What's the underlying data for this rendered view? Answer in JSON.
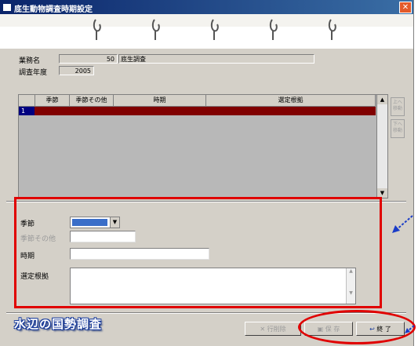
{
  "window": {
    "title": "底生動物調査時期設定",
    "close_glyph": "✕"
  },
  "info": {
    "business_name_label": "業務名",
    "business_code": "50",
    "business_name": "底生調査",
    "survey_year_label": "調査年度",
    "survey_year": "2005"
  },
  "grid": {
    "columns": [
      "季節",
      "季節その他",
      "時期",
      "選定根拠"
    ],
    "rows": [
      {
        "num": "1",
        "season": "",
        "season_other": "",
        "period": "",
        "reason": ""
      }
    ],
    "scroll_up": "▲",
    "scroll_down": "▼"
  },
  "side_buttons": {
    "move_up": "上へ移動",
    "move_down": "下へ移動"
  },
  "form": {
    "season_label": "季節",
    "season_other_label": "季節その他",
    "period_label": "時期",
    "reason_label": "選定根拠",
    "season_value": "",
    "season_other_value": "",
    "period_value": "",
    "reason_value": ""
  },
  "footer": {
    "logo_text": "水辺の国勢調査",
    "delete_row": "行削除",
    "save": "保 存",
    "exit": "終 了"
  },
  "colors": {
    "title_start": "#0a246a",
    "selected_row": "#800000",
    "highlight": "#e00000",
    "panel": "#d4d0c8"
  }
}
